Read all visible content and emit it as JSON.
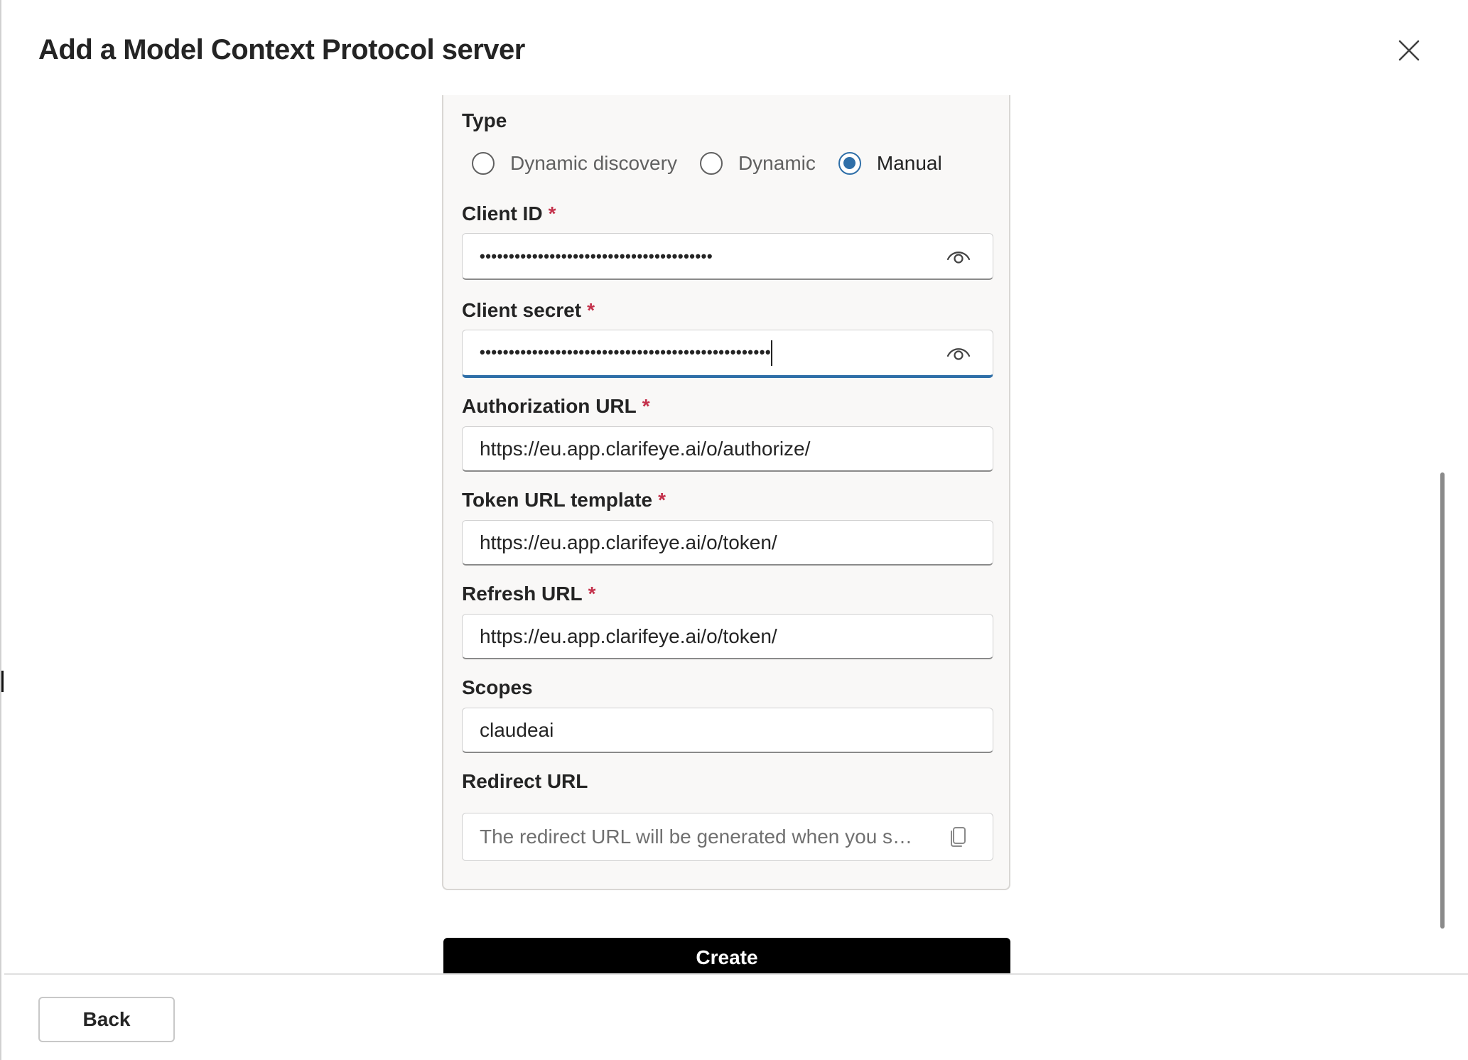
{
  "dialog": {
    "title": "Add a Model Context Protocol server",
    "close_icon": "close-icon"
  },
  "form": {
    "type": {
      "label": "Type",
      "options": [
        {
          "label": "Dynamic discovery",
          "selected": false
        },
        {
          "label": "Dynamic",
          "selected": false
        },
        {
          "label": "Manual",
          "selected": true
        }
      ]
    },
    "client_id": {
      "label": "Client ID",
      "required_mark": "*",
      "value": "••••••••••••••••••••••••••••••••••••••••",
      "icon": "eye-icon"
    },
    "client_secret": {
      "label": "Client secret",
      "required_mark": "*",
      "value": "••••••••••••••••••••••••••••••••••••••••••••••••••",
      "icon": "eye-icon"
    },
    "authorization_url": {
      "label": "Authorization URL",
      "required_mark": "*",
      "value": "https://eu.app.clarifeye.ai/o/authorize/"
    },
    "token_url_template": {
      "label": "Token URL template",
      "required_mark": "*",
      "value": "https://eu.app.clarifeye.ai/o/token/"
    },
    "refresh_url": {
      "label": "Refresh URL",
      "required_mark": "*",
      "value": "https://eu.app.clarifeye.ai/o/token/"
    },
    "scopes": {
      "label": "Scopes",
      "value": "claudeai"
    },
    "redirect_url": {
      "label": "Redirect URL",
      "placeholder": "The redirect URL will be generated when you sav...",
      "icon": "copy-icon"
    }
  },
  "actions": {
    "create_label": "Create",
    "back_label": "Back"
  },
  "colors": {
    "accent": "#2f6fa8",
    "required": "#c4314b",
    "primary_button": "#000000"
  }
}
